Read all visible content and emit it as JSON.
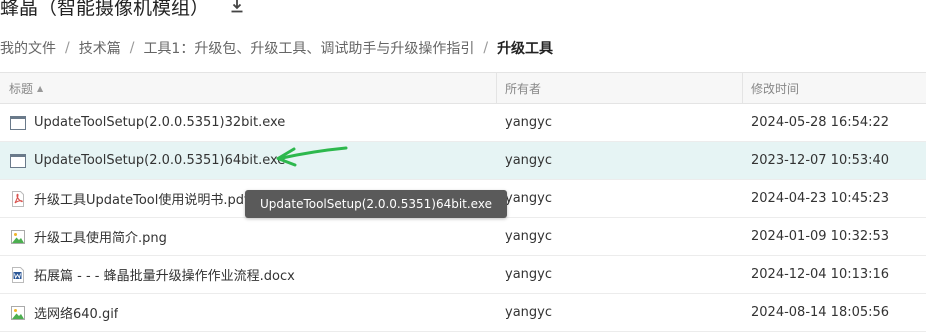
{
  "header": {
    "title": "蜂晶（智能摄像机模组）"
  },
  "breadcrumb": [
    {
      "label": "我的文件"
    },
    {
      "label": "技术篇"
    },
    {
      "label": "工具1：升级包、升级工具、调试助手与升级操作指引"
    },
    {
      "label": "升级工具"
    }
  ],
  "table": {
    "columns": {
      "name": "标题",
      "owner": "所有者",
      "modified": "修改时间"
    },
    "sort_indicator": "▲",
    "rows": [
      {
        "name": "UpdateToolSetup(2.0.0.5351)32bit.exe",
        "owner": "yangyc",
        "modified": "2024-05-28 16:54:22",
        "icon": "exe-file-icon"
      },
      {
        "name": "UpdateToolSetup(2.0.0.5351)64bit.exe",
        "owner": "yangyc",
        "modified": "2023-12-07 10:53:40",
        "icon": "exe-file-icon"
      },
      {
        "name": "升级工具UpdateTool使用说明书.pdf",
        "owner": "yangyc",
        "modified": "2024-04-23 10:45:23",
        "icon": "pdf-file-icon"
      },
      {
        "name": "升级工具使用简介.png",
        "owner": "yangyc",
        "modified": "2024-01-09 10:32:53",
        "icon": "image-file-icon"
      },
      {
        "name": "拓展篇 - - - 蜂晶批量升级操作作业流程.docx",
        "owner": "yangyc",
        "modified": "2024-12-04 10:13:16",
        "icon": "word-file-icon"
      },
      {
        "name": "选网络640.gif",
        "owner": "yangyc",
        "modified": "2024-08-14 18:05:56",
        "icon": "image-file-icon"
      }
    ]
  },
  "tooltip": {
    "text": "UpdateToolSetup(2.0.0.5351)64bit.exe"
  },
  "colors": {
    "hover_row": "#e6f4f4",
    "annotation_arrow": "#2db84d",
    "tooltip_bg": "#5a5a5a",
    "pdf_red": "#d9534f",
    "word_blue": "#2b5797",
    "image_green": "#4caf50"
  }
}
